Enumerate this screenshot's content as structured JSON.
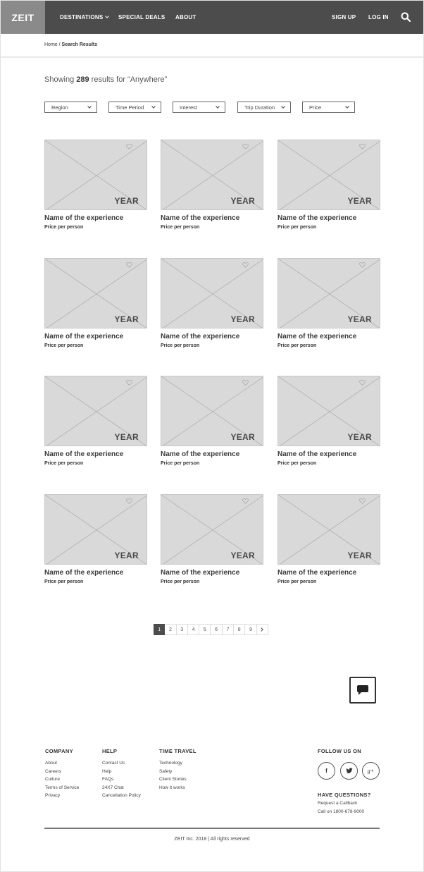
{
  "header": {
    "logo": "ZEIT",
    "nav": [
      {
        "label": "DESTINATIONS",
        "has_dropdown": true
      },
      {
        "label": "SPECIAL DEALS"
      },
      {
        "label": "ABOUT"
      }
    ],
    "sign_up": "SIGN UP",
    "log_in": "LOG IN",
    "search_icon": "search-icon",
    "bg_color": "#4c4c4c",
    "logo_bg": "#8a8a8a"
  },
  "breadcrumb": {
    "home": "Home",
    "separator": " / ",
    "current": "Search Results"
  },
  "results": {
    "prefix": "Showing ",
    "count": "289",
    "suffix": " results for “Anywhere”"
  },
  "filters": [
    "Region",
    "Time Period",
    "Interest",
    "Trip Duration",
    "Price"
  ],
  "cards": [
    {
      "year": "YEAR",
      "name": "Name of the experience",
      "price": "Price per person"
    },
    {
      "year": "YEAR",
      "name": "Name of the experience",
      "price": "Price per person"
    },
    {
      "year": "YEAR",
      "name": "Name of the experience",
      "price": "Price per person"
    },
    {
      "year": "YEAR",
      "name": "Name of the experience",
      "price": "Price per person"
    },
    {
      "year": "YEAR",
      "name": "Name of the experience",
      "price": "Price per person"
    },
    {
      "year": "YEAR",
      "name": "Name of the experience",
      "price": "Price per person"
    },
    {
      "year": "YEAR",
      "name": "Name of the experience",
      "price": "Price per person"
    },
    {
      "year": "YEAR",
      "name": "Name of the experience",
      "price": "Price per person"
    },
    {
      "year": "YEAR",
      "name": "Name of the experience",
      "price": "Price per person"
    },
    {
      "year": "YEAR",
      "name": "Name of the experience",
      "price": "Price per person"
    },
    {
      "year": "YEAR",
      "name": "Name of the experience",
      "price": "Price per person"
    },
    {
      "year": "YEAR",
      "name": "Name of the experience",
      "price": "Price per person"
    }
  ],
  "pagination": {
    "pages": [
      "1",
      "2",
      "3",
      "4",
      "5",
      "6",
      "7",
      "8",
      "9"
    ],
    "active": "1",
    "next_icon": "chevron-right-icon"
  },
  "chat": {
    "icon": "chat-bubble-icon"
  },
  "footer": {
    "company": {
      "title": "COMPANY",
      "links": [
        "About",
        "Careers",
        "Culture",
        "Terms of Service",
        "Privacy"
      ]
    },
    "help": {
      "title": "HELP",
      "links": [
        "Contact Us",
        "Help",
        "FAQs",
        "24X7 Chat",
        "Cancellation Policy"
      ]
    },
    "time_travel": {
      "title": "TIME TRAVEL",
      "links": [
        "Technology",
        "Safety",
        "Client Stories",
        "How it works"
      ]
    },
    "follow": {
      "title": "FOLLOW US ON",
      "icons": [
        {
          "name": "facebook-icon",
          "glyph": "f"
        },
        {
          "name": "twitter-icon",
          "glyph": "t"
        },
        {
          "name": "google-plus-icon",
          "glyph": "g+"
        }
      ]
    },
    "questions": {
      "title": "HAVE QUESTIONS?",
      "callback": "Request a Callback",
      "phone": "Call on 1800-678-9000"
    },
    "copyright": "ZEIT Inc. 2018 | All rights reserved"
  }
}
